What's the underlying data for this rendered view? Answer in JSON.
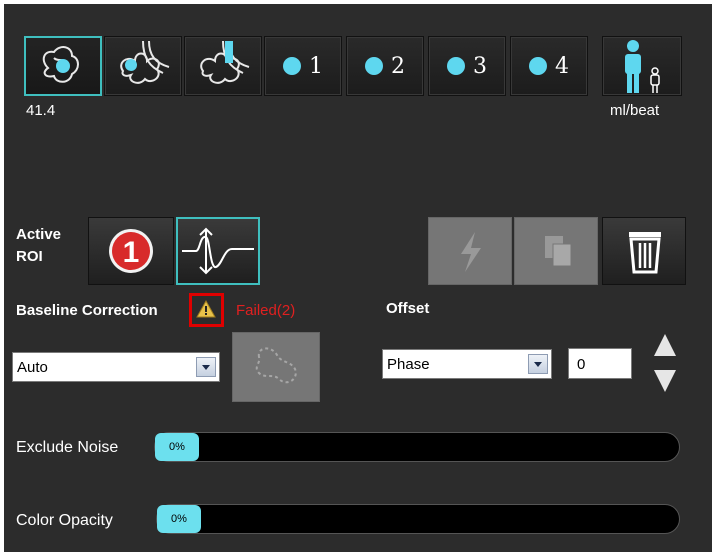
{
  "toolbar": {
    "buttons": [
      {
        "name": "flow-view-1",
        "icon": "heart-vessels-icon"
      },
      {
        "name": "flow-view-2",
        "icon": "vessel-branch-icon"
      },
      {
        "name": "flow-view-3",
        "icon": "vessel-branch-alt-icon"
      },
      {
        "name": "roi-1",
        "label": "1"
      },
      {
        "name": "roi-2",
        "label": "2"
      },
      {
        "name": "roi-3",
        "label": "3"
      },
      {
        "name": "roi-4",
        "label": "4"
      }
    ],
    "value": "41.4",
    "units": "ml/beat"
  },
  "active_roi": {
    "label_line1": "Active",
    "label_line2": "ROI",
    "number": "1"
  },
  "baseline": {
    "label": "Baseline Correction",
    "status": "Failed(2)",
    "mode": "Auto"
  },
  "offset": {
    "label": "Offset",
    "mode": "Phase",
    "value": "0"
  },
  "exclude_noise": {
    "label": "Exclude Noise",
    "value": "0%"
  },
  "color_opacity": {
    "label": "Color Opacity",
    "value": "0%"
  },
  "colors": {
    "accent": "#3fbfbf",
    "dot": "#5ed7ef",
    "status_fail": "#e02020",
    "badge": "#d82a2a"
  }
}
